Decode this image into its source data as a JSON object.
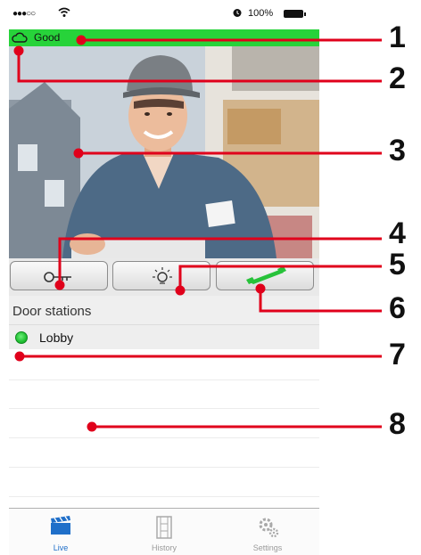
{
  "status_bar": {
    "signal": "●●●○○",
    "battery_text": "100%"
  },
  "connection": {
    "status_text": "Good",
    "color": "#27d33a",
    "icon": "cloud-icon"
  },
  "video": {
    "icon": "camera-feed"
  },
  "controls": [
    {
      "name": "unlock-door-button",
      "icon": "key-icon"
    },
    {
      "name": "light-button",
      "icon": "lightbulb-icon"
    },
    {
      "name": "answer-call-button",
      "icon": "handset-icon",
      "color": "#27c23a"
    }
  ],
  "door_stations": {
    "title": "Door stations",
    "items": [
      {
        "name": "Lobby",
        "status_color": "#21c033"
      }
    ]
  },
  "tabs": [
    {
      "label": "Live",
      "icon": "clapperboard-icon",
      "active": true
    },
    {
      "label": "History",
      "icon": "film-strip-icon",
      "active": false
    },
    {
      "label": "Settings",
      "icon": "gears-icon",
      "active": false
    }
  ],
  "callouts": [
    "1",
    "2",
    "3",
    "4",
    "5",
    "6",
    "7",
    "8"
  ],
  "accent_color": "#1f6fc9",
  "callout_color": "#e0001b"
}
